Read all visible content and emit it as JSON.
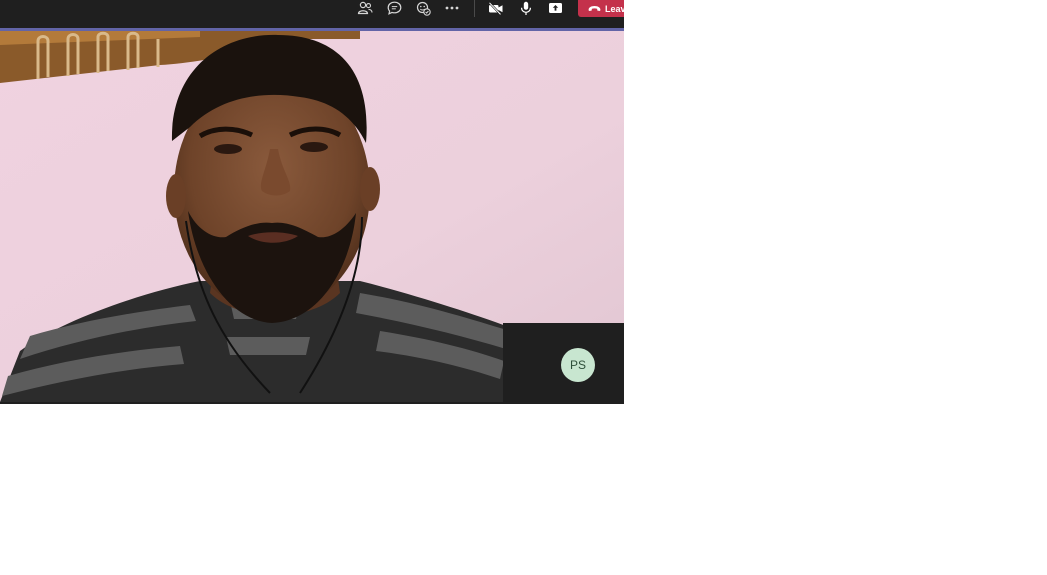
{
  "meeting": {
    "leave_label": "Leave",
    "self_initials": "PS"
  },
  "toolbar": {
    "icons": [
      "people-icon",
      "chat-icon",
      "reactions-icon",
      "more-icon",
      "camera-off-icon",
      "mic-icon",
      "share-icon",
      "phone-hangup-icon"
    ]
  },
  "colors": {
    "toolbar_bg": "#1f1f1f",
    "accent": "#6264a7",
    "leave_red": "#c4314b",
    "avatar_bg": "#c8e6d0"
  }
}
